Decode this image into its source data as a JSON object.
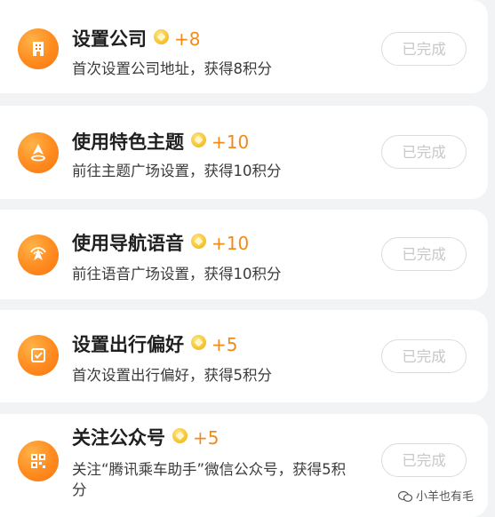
{
  "tasks": [
    {
      "title": "设置公司",
      "points": "+8",
      "desc": "首次设置公司地址，获得8积分",
      "button": "已完成",
      "icon": "building-icon"
    },
    {
      "title": "使用特色主题",
      "points": "+10",
      "desc": "前往主题广场设置，获得10积分",
      "button": "已完成",
      "icon": "location-pin-icon"
    },
    {
      "title": "使用导航语音",
      "points": "+10",
      "desc": "前往语音广场设置，获得10积分",
      "button": "已完成",
      "icon": "navigation-voice-icon"
    },
    {
      "title": "设置出行偏好",
      "points": "+5",
      "desc": "首次设置出行偏好，获得5积分",
      "button": "已完成",
      "icon": "checkbox-icon"
    },
    {
      "title": "关注公众号",
      "points": "+5",
      "desc": "关注“腾讯乘车助手”微信公众号，获得5积分",
      "button": "已完成",
      "icon": "qr-code-icon"
    }
  ],
  "watermark": "小羊也有毛",
  "colors": {
    "accent": "#f28a1a",
    "icon_bg": "#ff8a1f",
    "coin": "#f7c531",
    "done_text": "#c8c8c8"
  }
}
